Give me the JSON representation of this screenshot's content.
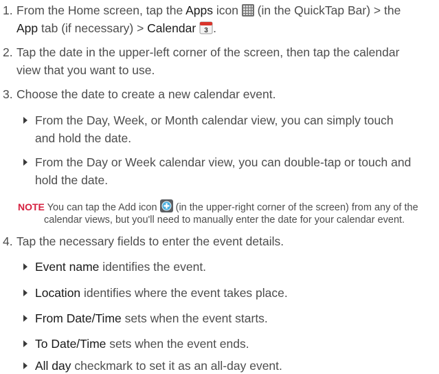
{
  "steps": [
    {
      "num": "1.",
      "l1_a": "From the Home screen, tap the ",
      "l1_apps": "Apps",
      "l1_b": " icon ",
      "l1_c": " (in the QuickTap Bar) > the",
      "l2_app": "App",
      "l2_a": " tab (if necessary) > ",
      "l2_calendar": "Calendar",
      "l2_b": "."
    },
    {
      "num": "2.",
      "l1": "Tap the date in the upper-left corner of the screen, then tap the calendar",
      "l2": "view that you want to use."
    },
    {
      "num": "3.",
      "l1": "Choose the date to create a new calendar event.",
      "bullets": [
        {
          "l1": "From the Day, Week, or Month calendar view, you can simply touch",
          "l2": "and hold the date."
        },
        {
          "l1": "From the Day or Week calendar view, you can double-tap or touch and",
          "l2": "hold the date."
        }
      ]
    },
    {
      "num": "4.",
      "l1": "Tap the necessary fields to enter the event details.",
      "bullets": [
        {
          "term": "Event name",
          "rest": " identifies the event."
        },
        {
          "term": "Location",
          "rest": " identifies where the event takes place."
        },
        {
          "term": "From Date/Time",
          "rest": " sets when the event starts."
        },
        {
          "term": "To Date/Time",
          "rest": " sets when the event ends."
        },
        {
          "term": "All day",
          "rest": " checkmark to set it as an all-day event."
        }
      ]
    }
  ],
  "note": {
    "label": "NOTE",
    "l1_a": " You can tap the Add icon ",
    "l1_b": " (in the upper-right corner of the screen) from any of the",
    "l2": "calendar views, but you'll need to manually enter the date for your calendar event."
  },
  "icons": {
    "apps": "apps-grid-icon",
    "calendar": "calendar-icon",
    "add": "add-plus-icon"
  },
  "colors": {
    "note_label": "#d6203f",
    "body_text": "#4d4d4d",
    "term_text": "#1a1a1a"
  }
}
